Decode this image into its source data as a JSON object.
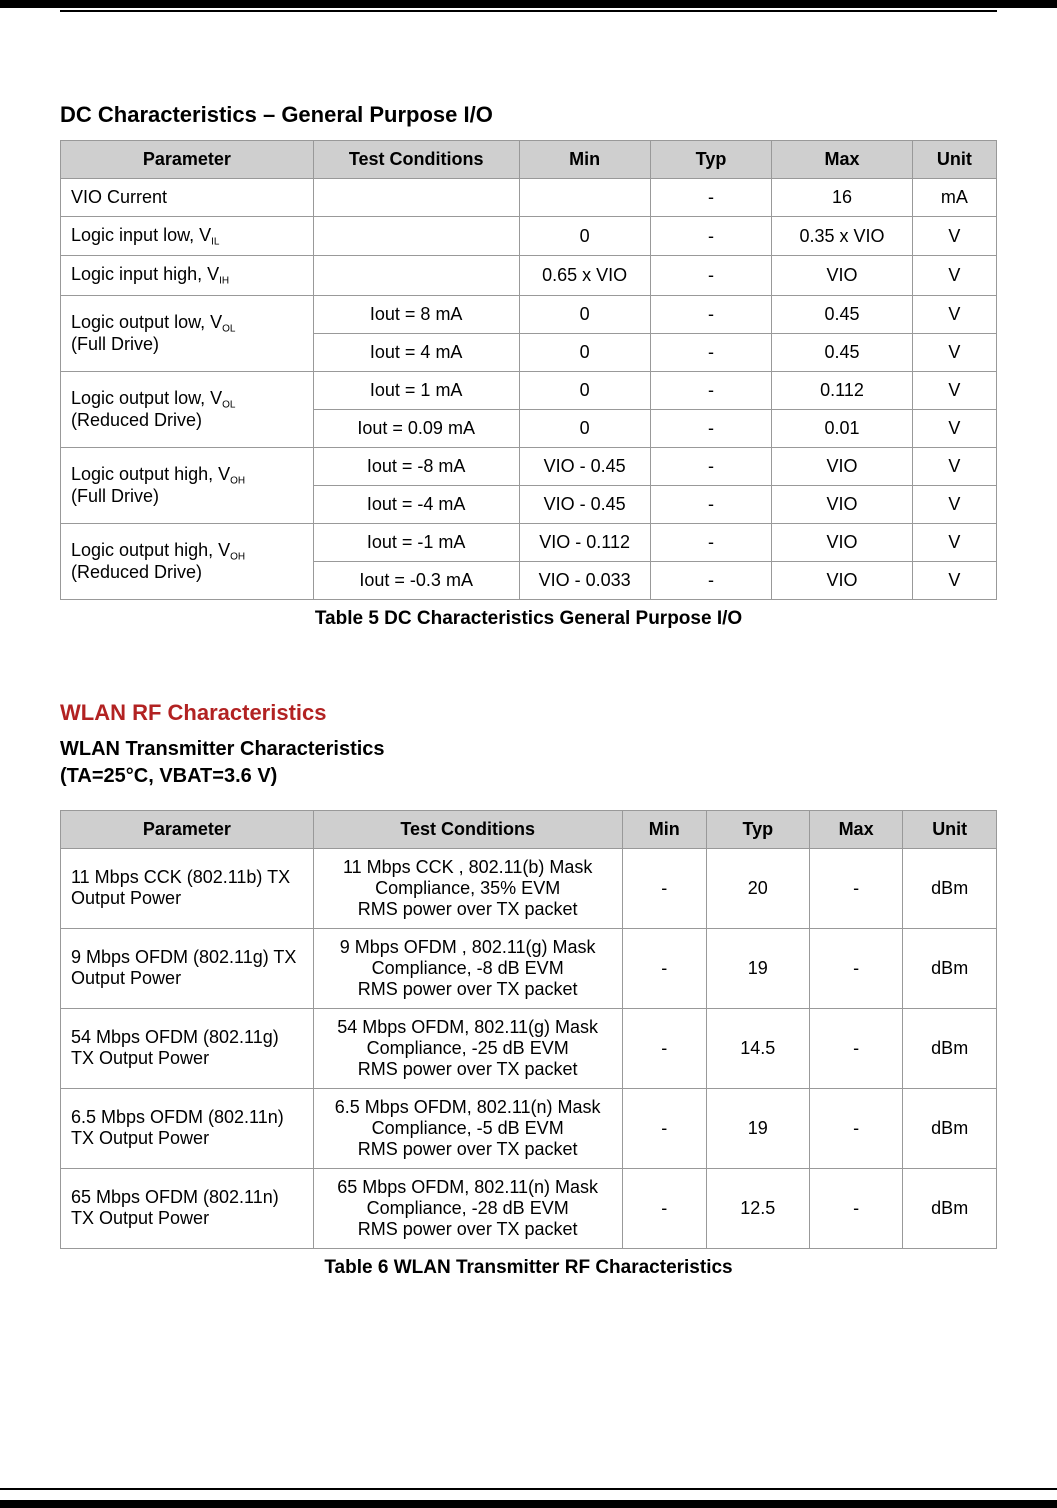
{
  "section1": {
    "title": "DC Characteristics – General Purpose I/O",
    "caption": "Table 5 DC Characteristics General Purpose I/O",
    "headers": [
      "Parameter",
      "Test Conditions",
      "Min",
      "Typ",
      "Max",
      "Unit"
    ],
    "rows": [
      {
        "param_html": "VIO Current",
        "cond": "",
        "min": "",
        "typ": "-",
        "max": "16",
        "unit": "mA"
      },
      {
        "param_html": "Logic input low, V<span class='inline-sub'><sub>IL</sub></span>",
        "cond": "",
        "min": "0",
        "typ": "-",
        "max": "0.35 x VIO",
        "unit": "V"
      },
      {
        "param_html": "Logic input high, V<span class='inline-sub'><sub>IH</sub></span>",
        "cond": "",
        "min": "0.65 x VIO",
        "typ": "-",
        "max": "VIO",
        "unit": "V"
      },
      {
        "param_html": "Logic output low, V<span class='inline-sub'><sub>OL</sub></span><br>(Full Drive)",
        "rowspan": 2,
        "cond": "Iout = 8 mA",
        "min": "0",
        "typ": "-",
        "max": "0.45",
        "unit": "V"
      },
      {
        "skip_param": true,
        "cond": "Iout = 4 mA",
        "min": "0",
        "typ": "-",
        "max": "0.45",
        "unit": "V"
      },
      {
        "param_html": "Logic output low, V<span class='inline-sub'><sub>OL</sub></span><br>(Reduced Drive)",
        "rowspan": 2,
        "cond": "Iout = 1 mA",
        "min": "0",
        "typ": "-",
        "max": "0.112",
        "unit": "V"
      },
      {
        "skip_param": true,
        "cond": "Iout = 0.09 mA",
        "min": "0",
        "typ": "-",
        "max": "0.01",
        "unit": "V"
      },
      {
        "param_html": "Logic output high, V<span class='inline-sub'><sub>OH</sub></span><br>(Full Drive)",
        "rowspan": 2,
        "cond": "Iout = -8 mA",
        "min": "VIO - 0.45",
        "typ": "-",
        "max": "VIO",
        "unit": "V"
      },
      {
        "skip_param": true,
        "cond": "Iout = -4 mA",
        "min": "VIO - 0.45",
        "typ": "-",
        "max": "VIO",
        "unit": "V"
      },
      {
        "param_html": "Logic output high, V<span class='inline-sub'><sub>OH</sub></span><br>(Reduced Drive)",
        "rowspan": 2,
        "cond": "Iout = -1 mA",
        "min": "VIO - 0.112",
        "typ": "-",
        "max": "VIO",
        "unit": "V"
      },
      {
        "skip_param": true,
        "cond": "Iout = -0.3 mA",
        "min": "VIO - 0.033",
        "typ": "-",
        "max": "VIO",
        "unit": "V"
      }
    ]
  },
  "section2": {
    "title_red": "WLAN RF Characteristics",
    "subheading_line1": "WLAN Transmitter Characteristics",
    "subheading_line2": "(TA=25°C, VBAT=3.6 V)",
    "caption": "Table 6 WLAN Transmitter RF Characteristics",
    "headers": [
      "Parameter",
      "Test Conditions",
      "Min",
      "Typ",
      "Max",
      "Unit"
    ],
    "rows": [
      {
        "param": "11 Mbps CCK (802.11b) TX Output Power",
        "cond": "11 Mbps CCK , 802.11(b) Mask Compliance, 35% EVM\nRMS power over TX packet",
        "min": "-",
        "typ": "20",
        "max": "-",
        "unit": "dBm"
      },
      {
        "param": "9 Mbps OFDM (802.11g) TX Output Power",
        "cond": "9 Mbps OFDM , 802.11(g) Mask Compliance, -8 dB EVM\nRMS power over TX packet",
        "min": "-",
        "typ": "19",
        "max": "-",
        "unit": "dBm"
      },
      {
        "param": "54 Mbps OFDM (802.11g) TX Output Power",
        "cond": "54 Mbps OFDM, 802.11(g) Mask Compliance, -25 dB EVM\nRMS power over TX packet",
        "min": "-",
        "typ": "14.5",
        "max": "-",
        "unit": "dBm"
      },
      {
        "param": "6.5 Mbps OFDM (802.11n) TX Output Power",
        "cond": "6.5 Mbps OFDM, 802.11(n) Mask Compliance, -5 dB EVM\nRMS power over TX packet",
        "min": "-",
        "typ": "19",
        "max": "-",
        "unit": "dBm"
      },
      {
        "param": "65 Mbps OFDM (802.11n) TX Output Power",
        "cond": "65 Mbps OFDM, 802.11(n) Mask Compliance, -28 dB EVM\nRMS power over TX packet",
        "min": "-",
        "typ": "12.5",
        "max": "-",
        "unit": "dBm"
      }
    ]
  }
}
